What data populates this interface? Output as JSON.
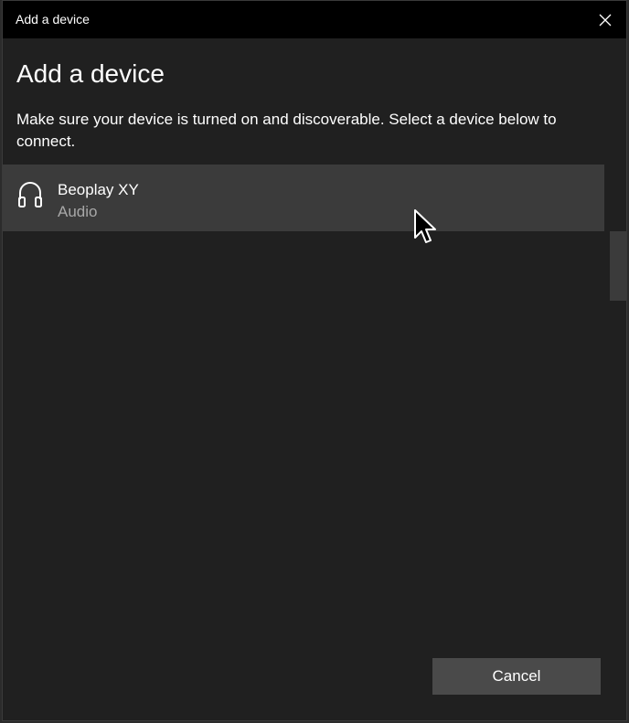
{
  "window": {
    "title": "Add a device",
    "close_icon": "close-icon"
  },
  "main": {
    "heading": "Add a device",
    "instructions": "Make sure your device is turned on and discoverable. Select a device below to connect.",
    "devices": [
      {
        "name": "Beoplay XY",
        "type": "Audio",
        "icon": "headphones-icon"
      }
    ]
  },
  "footer": {
    "cancel_label": "Cancel"
  },
  "colors": {
    "titlebar": "#000000",
    "background": "#202020",
    "selected_item": "#3b3b3b",
    "button": "#4a4a4a",
    "secondary_text": "#a8a8a8"
  }
}
